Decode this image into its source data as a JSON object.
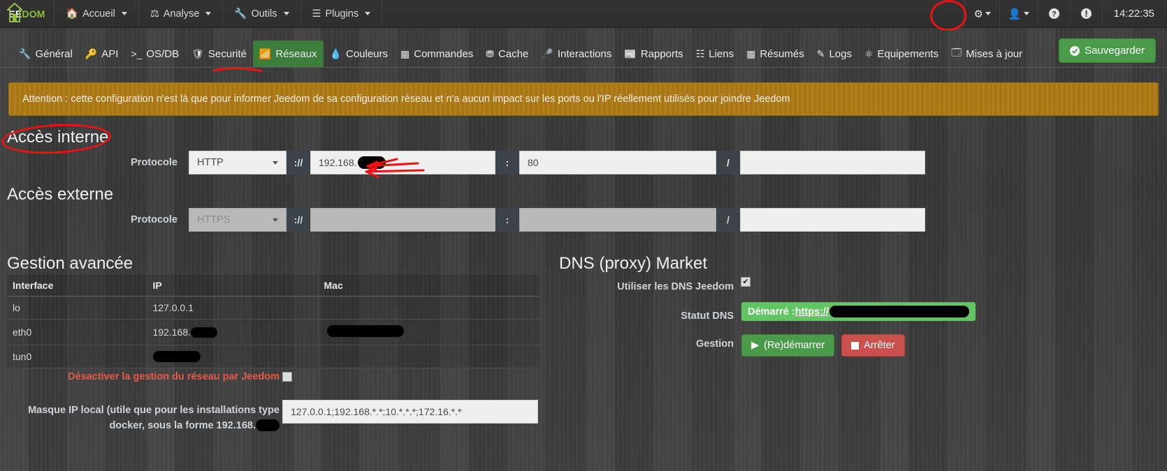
{
  "navbar": {
    "brand": {
      "name": "JEEDOM",
      "prefix": "",
      "lead": "EE",
      "tail": "DOM"
    },
    "items": [
      {
        "label": "Accueil",
        "icon": "home-icon",
        "caret": true
      },
      {
        "label": "Analyse",
        "icon": "analysis-icon",
        "caret": true
      },
      {
        "label": "Outils",
        "icon": "wrench-icon",
        "caret": true
      },
      {
        "label": "Plugins",
        "icon": "plugins-icon",
        "caret": true
      }
    ],
    "right": [
      {
        "name": "gears-icon",
        "glyph": "⚙",
        "caret": true
      },
      {
        "name": "user-icon",
        "glyph": "👤",
        "caret": true
      },
      {
        "name": "help-icon",
        "glyph": "?",
        "caret": false
      },
      {
        "name": "alert-icon",
        "glyph": "!",
        "caret": false
      }
    ],
    "clock": "14:22:35"
  },
  "tabs": [
    {
      "label": "Général",
      "icon": "wrench-icon",
      "active": false
    },
    {
      "label": "API",
      "icon": "key-icon",
      "active": false
    },
    {
      "label": "OS/DB",
      "icon": "terminal-icon",
      "active": false
    },
    {
      "label": "Securité",
      "icon": "shield-icon",
      "active": false
    },
    {
      "label": "Réseaux",
      "icon": "rss-icon",
      "active": true
    },
    {
      "label": "Couleurs",
      "icon": "droplet-icon",
      "active": false
    },
    {
      "label": "Commandes",
      "icon": "grid-icon",
      "active": false
    },
    {
      "label": "Cache",
      "icon": "cache-icon",
      "active": false
    },
    {
      "label": "Interactions",
      "icon": "microphone-icon",
      "active": false
    },
    {
      "label": "Rapports",
      "icon": "report-icon",
      "active": false
    },
    {
      "label": "Liens",
      "icon": "sitemap-icon",
      "active": false
    },
    {
      "label": "Résumés",
      "icon": "table-icon",
      "active": false
    },
    {
      "label": "Logs",
      "icon": "edit-icon",
      "active": false
    },
    {
      "label": "Equipements",
      "icon": "gear-circle-icon",
      "active": false
    },
    {
      "label": "Mises à jour",
      "icon": "update-icon",
      "active": false
    }
  ],
  "save_button": {
    "label": "Sauvegarder",
    "icon": "check-circle-icon",
    "color": "#4a9a4a"
  },
  "alert": {
    "text": "Attention : cette configuration n'est là que pour informer Jeedom de sa configuration réseau et n'a aucun impact sur les ports ou l'IP réellement utilisés pour joindre Jeedom",
    "color": "#b07915"
  },
  "internal_access": {
    "title": "Accès interne",
    "protocol_label": "Protocole",
    "protocol_value": "HTTP",
    "scheme_sep": "://",
    "ip_value": "192.168.",
    "ip_redacted": true,
    "port_sep": ":",
    "port_value": "80",
    "path_sep": "/",
    "path_value": ""
  },
  "external_access": {
    "title": "Accès externe",
    "protocol_label": "Protocole",
    "protocol_value": "HTTPS",
    "scheme_sep": "://",
    "ip_value": "",
    "port_sep": ":",
    "port_value": "",
    "path_sep": "/",
    "path_value": "",
    "disabled": true
  },
  "advanced": {
    "title": "Gestion avancée",
    "columns": [
      "Interface",
      "IP",
      "Mac"
    ],
    "rows": [
      {
        "interface": "lo",
        "ip": "127.0.0.1",
        "ip_redacted": false,
        "mac": "",
        "mac_redacted": false
      },
      {
        "interface": "eth0",
        "ip": "192.168.",
        "ip_redacted": true,
        "mac": "",
        "mac_redacted": true
      },
      {
        "interface": "tun0",
        "ip": "",
        "ip_redacted": true,
        "mac": "",
        "mac_redacted": false
      }
    ],
    "disable_label": "Désactiver la gestion du réseau par Jeedom",
    "disable_checked": false,
    "mask_label_line1": "Masque IP local (utile que pour les installations type",
    "mask_label_line2": "docker, sous la forme 192.168.",
    "mask_value": "127.0.0.1;192.168.*.*;10.*.*.*;172.16.*.*"
  },
  "dns": {
    "title": "DNS (proxy) Market",
    "use_label": "Utiliser les DNS Jeedom",
    "use_checked": true,
    "status_label": "Statut DNS",
    "status_prefix": "Démarré : ",
    "status_url": "https://",
    "status_color": "#62c462",
    "manage_label": "Gestion",
    "restart_button": "(Re)démarrer",
    "stop_button": "Arrêter",
    "restart_color": "#4a9a4a",
    "stop_color": "#c9504c"
  },
  "annotations": {
    "color": "#ee1111",
    "circle_gears": "gears-icon circled in red",
    "circle_interne": "Accès interne circled in red",
    "underline_reseaux": "Réseaux tab underlined in red",
    "arrows_ip": "two red arrows pointing at internal IP field"
  }
}
